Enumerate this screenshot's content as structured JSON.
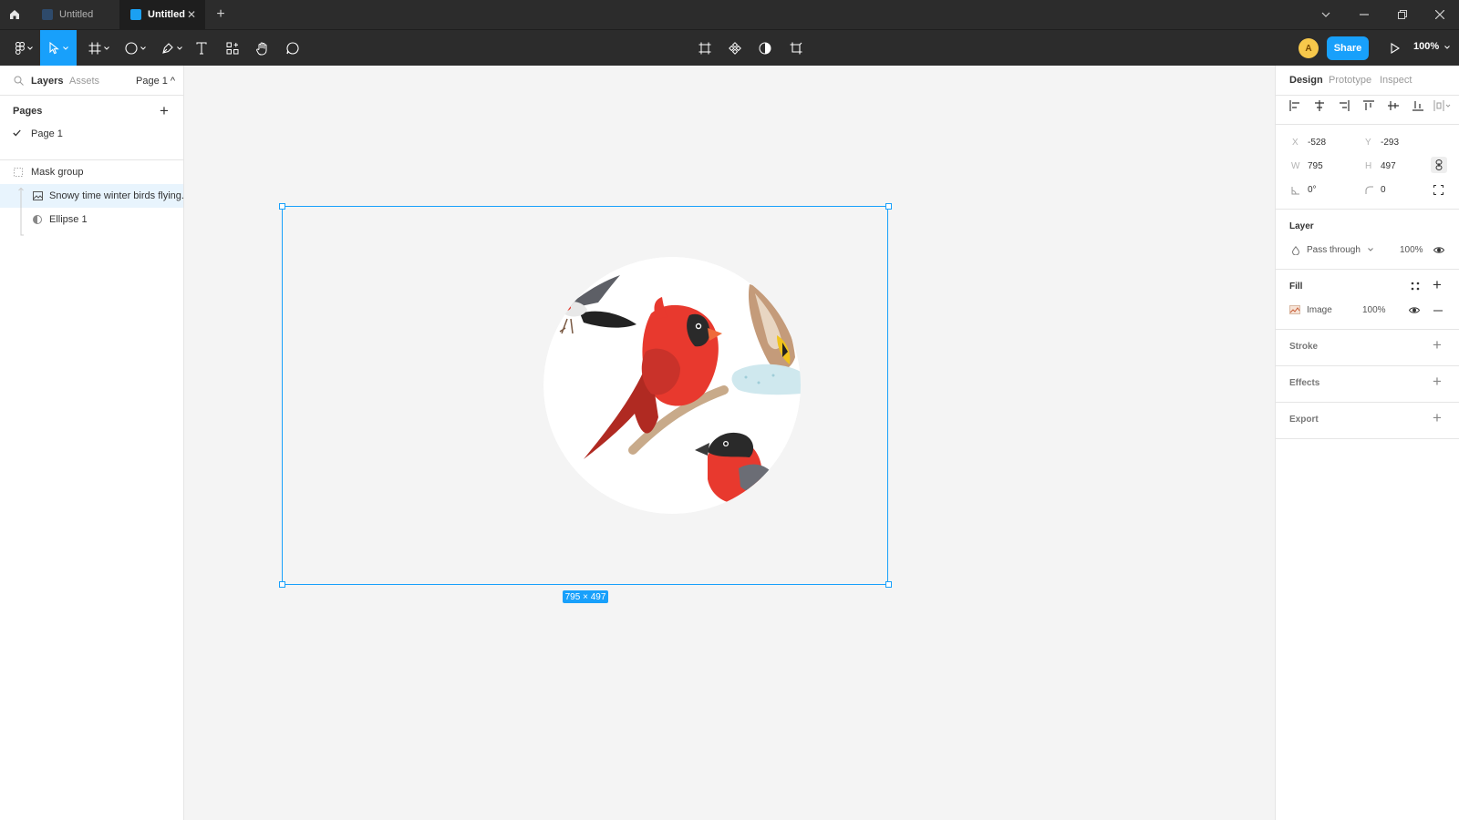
{
  "titlebar": {
    "tabs": [
      {
        "label": "Untitled",
        "active": false
      },
      {
        "label": "Untitled",
        "active": true
      }
    ]
  },
  "toolbar": {
    "avatar_initial": "A",
    "share_label": "Share",
    "zoom_label": "100%"
  },
  "left_panel": {
    "tabs": [
      "Layers",
      "Assets"
    ],
    "page_selector": "Page 1 ^",
    "pages_heading": "Pages",
    "pages": [
      {
        "label": "Page 1",
        "selected": true
      }
    ],
    "layers": [
      {
        "label": "Mask group",
        "icon": "mask-group-icon"
      },
      {
        "label": "Snowy time winter birds flying...",
        "icon": "image-icon",
        "highlighted": true
      },
      {
        "label": "Ellipse 1",
        "icon": "mask-ellipse-icon"
      }
    ]
  },
  "canvas": {
    "selection_size": "795 × 497"
  },
  "right_panel": {
    "tabs": [
      "Design",
      "Prototype",
      "Inspect"
    ],
    "active_tab": "Design",
    "x_label": "X",
    "x_value": "-528",
    "y_label": "Y",
    "y_value": "-293",
    "w_label": "W",
    "w_value": "795",
    "h_label": "H",
    "h_value": "497",
    "rotation_value": "0°",
    "radius_value": "0",
    "layer_heading": "Layer",
    "blend_mode": "Pass through",
    "layer_opacity": "100%",
    "fill_heading": "Fill",
    "fill_type": "Image",
    "fill_opacity": "100%",
    "stroke_heading": "Stroke",
    "effects_heading": "Effects",
    "export_heading": "Export"
  },
  "help_label": "?",
  "colors": {
    "accent": "#18a0fb",
    "chrome": "#2c2c2c",
    "canvas": "#f4f4f4"
  }
}
